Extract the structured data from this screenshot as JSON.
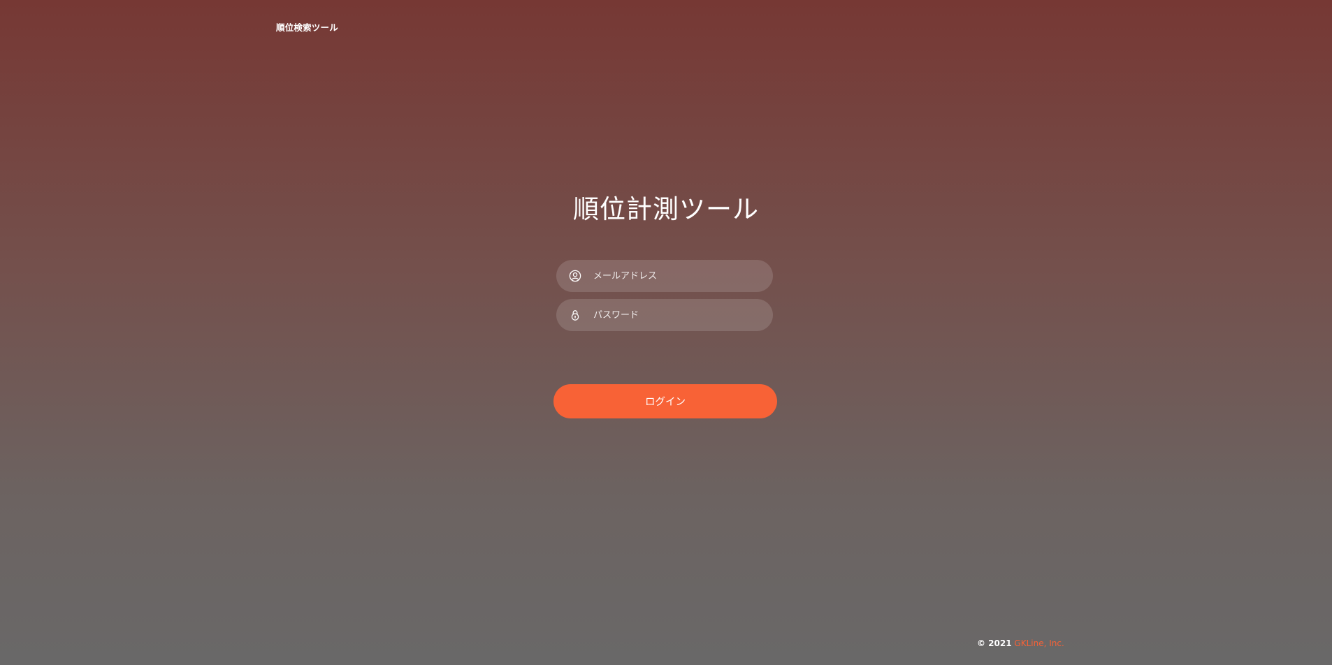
{
  "header": {
    "brand": "順位検索ツール"
  },
  "login": {
    "title": "順位計測ツール",
    "email": {
      "value": "",
      "placeholder": "メールアドレス",
      "icon": "user-circle-icon"
    },
    "password": {
      "value": "",
      "placeholder": "パスワード",
      "icon": "lock-icon"
    },
    "submit_label": "ログイン"
  },
  "footer": {
    "copyright": "© 2021",
    "company": "GKLine, Inc."
  },
  "colors": {
    "accent": "#f86236",
    "background_top": "#763834",
    "background_bottom": "#696868"
  }
}
